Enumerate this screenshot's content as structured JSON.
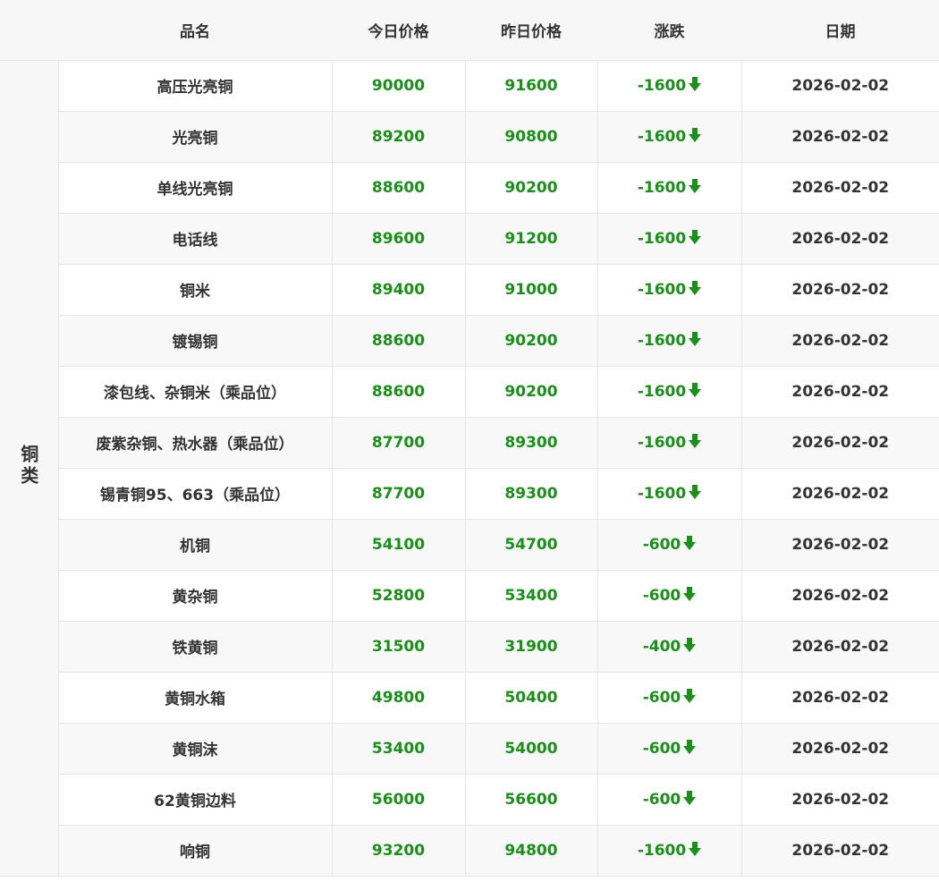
{
  "header": {
    "name": "品名",
    "today": "今日价格",
    "yesterday": "昨日价格",
    "change": "涨跌",
    "date": "日期"
  },
  "category": "铜类",
  "colors": {
    "price_green": "#1a8f1a",
    "arrow_green": "#1a8f1a",
    "text": "#333333",
    "header_bg": "#f7f7f7"
  },
  "change_icon": "down-arrow-icon",
  "rows": [
    {
      "name": "高压光亮铜",
      "today": "90000",
      "yesterday": "91600",
      "change": "-1600",
      "date": "2026-02-02"
    },
    {
      "name": "光亮铜",
      "today": "89200",
      "yesterday": "90800",
      "change": "-1600",
      "date": "2026-02-02"
    },
    {
      "name": "单线光亮铜",
      "today": "88600",
      "yesterday": "90200",
      "change": "-1600",
      "date": "2026-02-02"
    },
    {
      "name": "电话线",
      "today": "89600",
      "yesterday": "91200",
      "change": "-1600",
      "date": "2026-02-02"
    },
    {
      "name": "铜米",
      "today": "89400",
      "yesterday": "91000",
      "change": "-1600",
      "date": "2026-02-02"
    },
    {
      "name": "镀锡铜",
      "today": "88600",
      "yesterday": "90200",
      "change": "-1600",
      "date": "2026-02-02"
    },
    {
      "name": "漆包线、杂铜米（乘品位）",
      "today": "88600",
      "yesterday": "90200",
      "change": "-1600",
      "date": "2026-02-02"
    },
    {
      "name": "废紫杂铜、热水器（乘品位）",
      "today": "87700",
      "yesterday": "89300",
      "change": "-1600",
      "date": "2026-02-02"
    },
    {
      "name": "锡青铜95、663（乘品位）",
      "today": "87700",
      "yesterday": "89300",
      "change": "-1600",
      "date": "2026-02-02"
    },
    {
      "name": "机铜",
      "today": "54100",
      "yesterday": "54700",
      "change": "-600",
      "date": "2026-02-02"
    },
    {
      "name": "黄杂铜",
      "today": "52800",
      "yesterday": "53400",
      "change": "-600",
      "date": "2026-02-02"
    },
    {
      "name": "铁黄铜",
      "today": "31500",
      "yesterday": "31900",
      "change": "-400",
      "date": "2026-02-02"
    },
    {
      "name": "黄铜水箱",
      "today": "49800",
      "yesterday": "50400",
      "change": "-600",
      "date": "2026-02-02"
    },
    {
      "name": "黄铜沫",
      "today": "53400",
      "yesterday": "54000",
      "change": "-600",
      "date": "2026-02-02"
    },
    {
      "name": "62黄铜边料",
      "today": "56000",
      "yesterday": "56600",
      "change": "-600",
      "date": "2026-02-02"
    },
    {
      "name": "响铜",
      "today": "93200",
      "yesterday": "94800",
      "change": "-1600",
      "date": "2026-02-02"
    }
  ]
}
